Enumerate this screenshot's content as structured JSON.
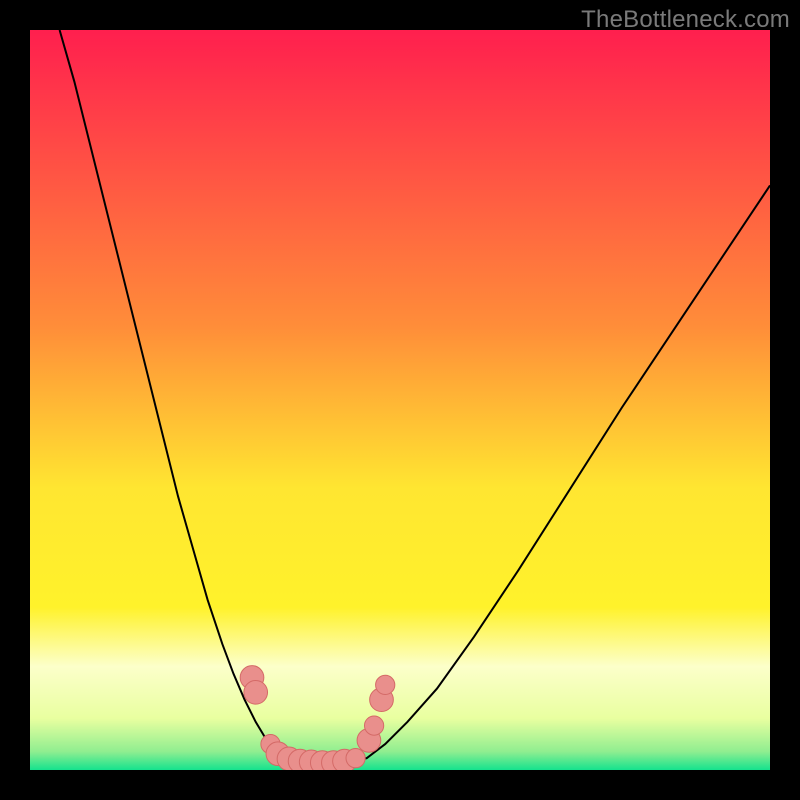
{
  "watermark": "TheBottleneck.com",
  "colors": {
    "frame": "#000000",
    "gradient_stops": [
      {
        "offset": 0.0,
        "color": "#ff1f4e"
      },
      {
        "offset": 0.4,
        "color": "#ff8d39"
      },
      {
        "offset": 0.62,
        "color": "#ffe631"
      },
      {
        "offset": 0.78,
        "color": "#fff22b"
      },
      {
        "offset": 0.86,
        "color": "#fcffca"
      },
      {
        "offset": 0.93,
        "color": "#e9ffa0"
      },
      {
        "offset": 0.975,
        "color": "#90ee90"
      },
      {
        "offset": 1.0,
        "color": "#14e28e"
      }
    ],
    "curve": "#000000",
    "marker_fill": "#e98f8c",
    "marker_stroke": "#d46a67"
  },
  "chart_data": {
    "type": "line",
    "title": "",
    "xlabel": "",
    "ylabel": "",
    "xlim": [
      0,
      100
    ],
    "ylim": [
      0,
      100
    ],
    "grid": false,
    "legend": false,
    "series": [
      {
        "name": "left-curve",
        "x": [
          4,
          6,
          8,
          10,
          12,
          14,
          16,
          18,
          20,
          22,
          24,
          26,
          27.5,
          29,
          30.5,
          32,
          33.5,
          35
        ],
        "y": [
          100,
          93,
          85,
          77,
          69,
          61,
          53,
          45,
          37,
          30,
          23,
          17,
          13,
          9.5,
          6.5,
          4,
          2.5,
          1.5
        ]
      },
      {
        "name": "minimum-flat",
        "x": [
          35,
          36.5,
          38,
          39.5,
          41,
          42.5,
          44,
          45.5
        ],
        "y": [
          1.5,
          1.2,
          1.1,
          1.0,
          1.0,
          1.1,
          1.3,
          1.6
        ]
      },
      {
        "name": "right-curve",
        "x": [
          45.5,
          48,
          51,
          55,
          60,
          66,
          73,
          80,
          88,
          96,
          100
        ],
        "y": [
          1.6,
          3.5,
          6.5,
          11,
          18,
          27,
          38,
          49,
          61,
          73,
          79
        ]
      }
    ],
    "markers": [
      {
        "x": 30.0,
        "y": 12.5,
        "r": 1.6
      },
      {
        "x": 30.5,
        "y": 10.5,
        "r": 1.6
      },
      {
        "x": 32.5,
        "y": 3.5,
        "r": 1.3
      },
      {
        "x": 33.5,
        "y": 2.2,
        "r": 1.6
      },
      {
        "x": 35.0,
        "y": 1.5,
        "r": 1.6
      },
      {
        "x": 36.5,
        "y": 1.2,
        "r": 1.6
      },
      {
        "x": 38.0,
        "y": 1.1,
        "r": 1.6
      },
      {
        "x": 39.5,
        "y": 1.0,
        "r": 1.6
      },
      {
        "x": 41.0,
        "y": 1.0,
        "r": 1.6
      },
      {
        "x": 42.5,
        "y": 1.2,
        "r": 1.6
      },
      {
        "x": 44.0,
        "y": 1.6,
        "r": 1.3
      },
      {
        "x": 45.8,
        "y": 4.0,
        "r": 1.6
      },
      {
        "x": 46.5,
        "y": 6.0,
        "r": 1.3
      },
      {
        "x": 47.5,
        "y": 9.5,
        "r": 1.6
      },
      {
        "x": 48.0,
        "y": 11.5,
        "r": 1.3
      }
    ]
  }
}
